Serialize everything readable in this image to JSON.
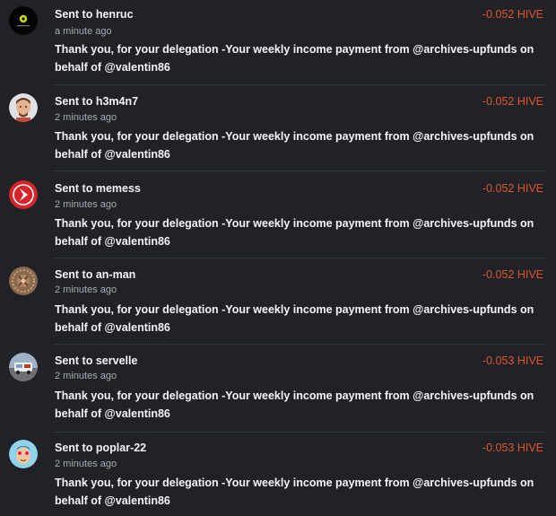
{
  "theme": {
    "background": "#212228",
    "amount_color": "#e0562a",
    "muted_text": "#a9acb3"
  },
  "transfers": [
    {
      "prefix": "Sent to",
      "account": "henruc",
      "time": "a minute ago",
      "amount": "-0.052 HIVE",
      "memo": "Thank you, for your delegation -Your weekly income payment from @archives-upfunds on behalf of @valentin86",
      "avatar": "henruc-avatar-icon"
    },
    {
      "prefix": "Sent to",
      "account": "h3m4n7",
      "time": "2 minutes ago",
      "amount": "-0.052 HIVE",
      "memo": "Thank you, for your delegation -Your weekly income payment from @archives-upfunds on behalf of @valentin86",
      "avatar": "h3m4n7-avatar-icon"
    },
    {
      "prefix": "Sent to",
      "account": "memess",
      "time": "2 minutes ago",
      "amount": "-0.052 HIVE",
      "memo": "Thank you, for your delegation -Your weekly income payment from @archives-upfunds on behalf of @valentin86",
      "avatar": "memess-avatar-icon"
    },
    {
      "prefix": "Sent to",
      "account": "an-man",
      "time": "2 minutes ago",
      "amount": "-0.052 HIVE",
      "memo": "Thank you, for your delegation -Your weekly income payment from @archives-upfunds on behalf of @valentin86",
      "avatar": "an-man-avatar-icon"
    },
    {
      "prefix": "Sent to",
      "account": "servelle",
      "time": "2 minutes ago",
      "amount": "-0.053 HIVE",
      "memo": "Thank you, for your delegation -Your weekly income payment from @archives-upfunds on behalf of @valentin86",
      "avatar": "servelle-avatar-icon"
    },
    {
      "prefix": "Sent to",
      "account": "poplar-22",
      "time": "2 minutes ago",
      "amount": "-0.053 HIVE",
      "memo": "Thank you, for your delegation -Your weekly income payment from @archives-upfunds on behalf of @valentin86",
      "avatar": "poplar-22-avatar-icon"
    }
  ]
}
